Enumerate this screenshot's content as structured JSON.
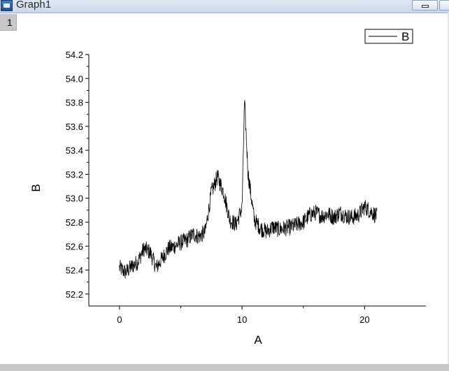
{
  "window": {
    "title": "Graph1",
    "icon": "graph-window-icon",
    "layer_label": "1",
    "buttons": [
      "minimize-icon",
      "maximize-icon"
    ]
  },
  "chart_data": {
    "type": "line",
    "xlabel": "A",
    "ylabel": "B",
    "xlim": [
      -2.5,
      25
    ],
    "ylim": [
      52.1,
      54.2
    ],
    "x_ticks": [
      0,
      10,
      20
    ],
    "x_tick_labels": [
      "0",
      "10",
      "20"
    ],
    "y_ticks": [
      52.2,
      52.4,
      52.6,
      52.8,
      53.0,
      53.2,
      53.4,
      53.6,
      53.8,
      54.0,
      54.2
    ],
    "y_tick_labels": [
      "52.2",
      "52.4",
      "52.6",
      "52.8",
      "53.0",
      "53.2",
      "53.4",
      "53.6",
      "53.8",
      "54.0",
      "54.2"
    ],
    "legend": {
      "position": "top-right",
      "entries": [
        "B"
      ]
    },
    "series": [
      {
        "name": "B",
        "color": "#000000",
        "x": [
          0,
          0.5,
          1,
          1.5,
          2,
          2.5,
          3,
          3.5,
          4,
          4.5,
          5,
          5.5,
          6,
          6.5,
          7,
          7.5,
          8,
          8.5,
          9,
          9.5,
          10,
          10.2,
          10.5,
          11,
          11.5,
          12,
          12.5,
          13,
          13.5,
          14,
          14.5,
          15,
          15.5,
          16,
          16.5,
          17,
          17.5,
          18,
          18.5,
          19,
          19.5,
          20,
          20.5,
          21
        ],
        "y": [
          52.42,
          52.38,
          52.43,
          52.47,
          52.58,
          52.55,
          52.42,
          52.5,
          52.58,
          52.6,
          52.63,
          52.65,
          52.7,
          52.68,
          52.72,
          53.05,
          53.18,
          53.05,
          52.82,
          52.78,
          52.92,
          53.8,
          53.2,
          52.82,
          52.75,
          52.72,
          52.76,
          52.74,
          52.75,
          52.76,
          52.78,
          52.8,
          52.86,
          52.88,
          52.85,
          52.87,
          52.84,
          52.88,
          52.85,
          52.84,
          52.86,
          52.93,
          52.89,
          52.85
        ]
      }
    ]
  }
}
